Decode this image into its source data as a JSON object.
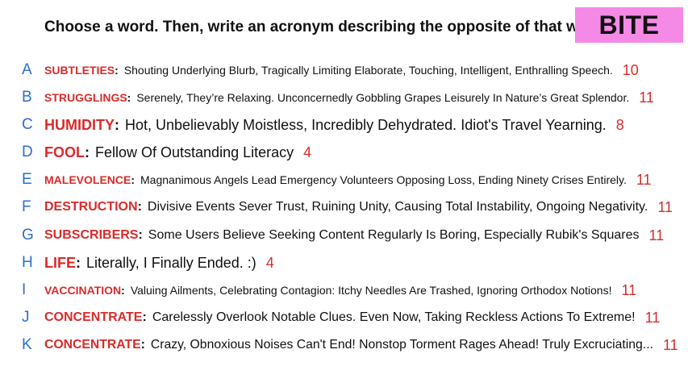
{
  "prompt": "Choose a word. Then, write an acronym describing the opposite of that word!",
  "badge": {
    "label": "BITE",
    "color": "#f58ae6"
  },
  "colors": {
    "letter": "#2a6fcf",
    "word": "#d92b2b",
    "score": "#d92b2b",
    "text": "#111111"
  },
  "entries": [
    {
      "letter": "A",
      "word": "SUBTLETIES",
      "acronym": "Shouting Underlying Blurb, Tragically Limiting Elaborate, Touching, Intelligent, Enthralling Speech.",
      "score": "10"
    },
    {
      "letter": "B",
      "word": "STRUGGLINGS",
      "acronym": "Serenely, They’re Relaxing. Unconcernedly Gobbling Grapes Leisurely In Nature’s Great Splendor.",
      "score": "11"
    },
    {
      "letter": "C",
      "word": "HUMIDITY",
      "acronym": "Hot, Unbelievably Moistless, Incredibly Dehydrated. Idiot's Travel Yearning.",
      "score": "8"
    },
    {
      "letter": "D",
      "word": "FOOL",
      "acronym": "Fellow Of Outstanding Literacy",
      "score": "4"
    },
    {
      "letter": "E",
      "word": "MALEVOLENCE",
      "acronym": "Magnanimous Angels Lead Emergency Volunteers Opposing Loss, Ending Ninety Crises Entirely.",
      "score": "11"
    },
    {
      "letter": "F",
      "word": "DESTRUCTION",
      "acronym": "Divisive Events Sever Trust, Ruining Unity, Causing Total Instability, Ongoing Negativity.",
      "score": "11"
    },
    {
      "letter": "G",
      "word": "SUBSCRIBERS",
      "acronym": "Some Users Believe Seeking Content Regularly Is Boring, Especially Rubik's Squares",
      "score": "11"
    },
    {
      "letter": "H",
      "word": "LIFE",
      "acronym": "Literally, I Finally Ended. :)",
      "score": "4"
    },
    {
      "letter": "I",
      "word": "VACCINATION",
      "acronym": "Valuing Ailments, Celebrating Contagion: Itchy Needles Are Trashed, Ignoring Orthodox Notions!",
      "score": "11"
    },
    {
      "letter": "J",
      "word": "CONCENTRATE",
      "acronym": "Carelessly Overlook Notable Clues. Even Now, Taking Reckless Actions To Extreme!",
      "score": "11"
    },
    {
      "letter": "K",
      "word": "CONCENTRATE",
      "acronym": "Crazy, Obnoxious Noises Can't End! Nonstop Torment Rages Ahead! Truly Excruciating...",
      "score": "11"
    }
  ]
}
